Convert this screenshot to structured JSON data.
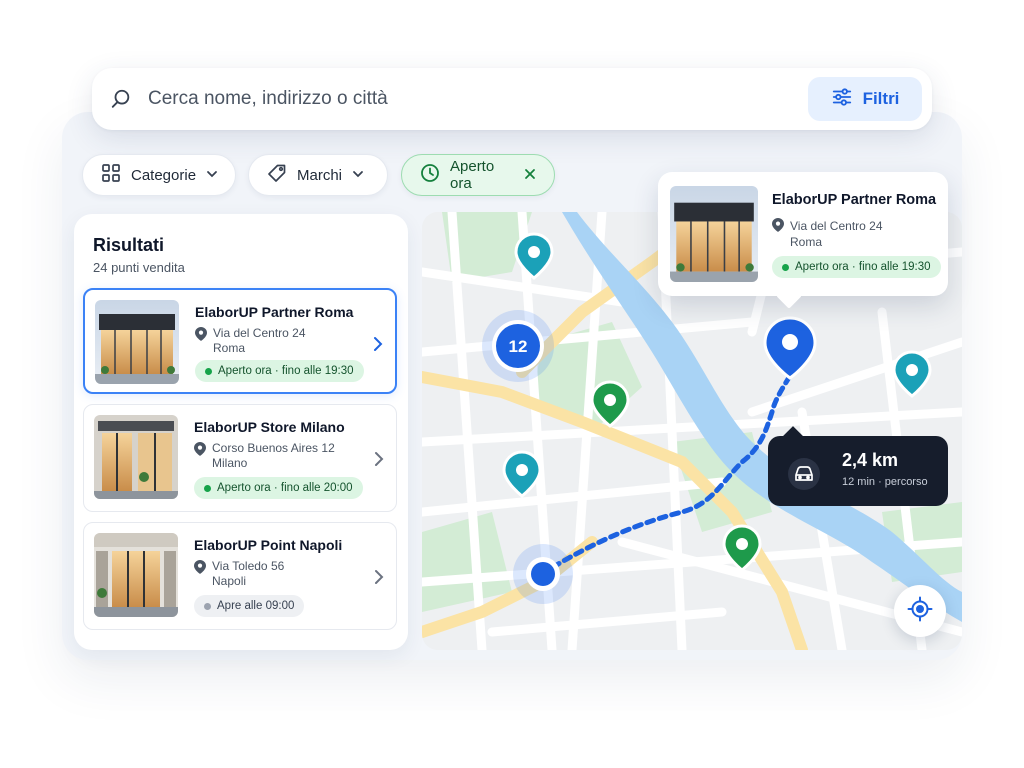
{
  "search": {
    "placeholder": "Cerca nome, indirizzo o città",
    "filter_label": "Filtri"
  },
  "chips": [
    {
      "label": "Categorie",
      "icon": "grid-icon"
    },
    {
      "label": "Marchi",
      "icon": "tag-icon"
    },
    {
      "label": "Aperto ora",
      "icon": "clock-icon",
      "active": true
    }
  ],
  "results": {
    "title": "Risultati",
    "count": "24 punti vendita",
    "items": [
      {
        "name": "ElaborUP Partner Roma",
        "address": "Via del Centro 24",
        "city": "Roma",
        "status": "open",
        "status_text": "Aperto ora · fino alle 19:30",
        "selected": true
      },
      {
        "name": "ElaborUP Store Milano",
        "address": "Corso Buenos Aires 12",
        "city": "Milano",
        "status": "open",
        "status_text": "Aperto ora · fino alle 20:00",
        "selected": false
      },
      {
        "name": "ElaborUP Point Napoli",
        "address": "Via Toledo 56",
        "city": "Napoli",
        "status": "closed",
        "status_text": "Apre alle 09:00",
        "selected": false
      }
    ]
  },
  "map": {
    "cluster_count": "12",
    "popup": {
      "name": "ElaborUP Partner Roma",
      "address": "Via del Centro 24",
      "city": "Roma",
      "status_text": "Aperto ora · fino alle 19:30"
    },
    "route": {
      "distance": "2,4 km",
      "detail": "12 min · percorso"
    }
  },
  "colors": {
    "accent": "#1d62e0",
    "open": "#16a34a",
    "teal_pin": "#1ba1b8",
    "green_pin": "#1e9a4b",
    "river": "#a9d3f5"
  }
}
